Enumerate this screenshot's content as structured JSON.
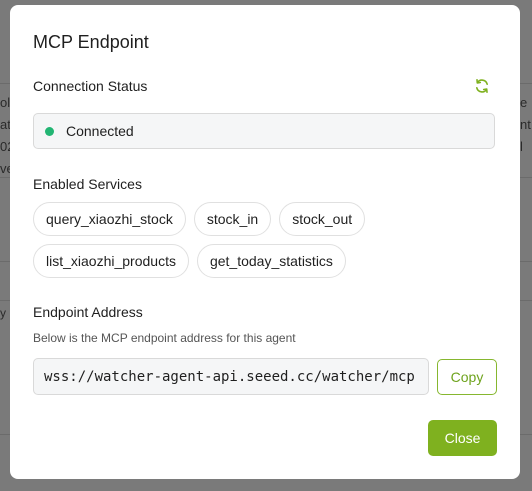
{
  "background": {
    "left_fragment": [
      "ol",
      "at",
      "02",
      "ve"
    ],
    "right_fragment": [
      "e",
      "nt,",
      "l",
      ""
    ],
    "small_left_fragment": "y"
  },
  "modal": {
    "title": "MCP Endpoint",
    "connection": {
      "label": "Connection Status",
      "status": "Connected",
      "status_color": "#22b573",
      "refresh_icon": "refresh-icon"
    },
    "services": {
      "label": "Enabled Services",
      "rows": [
        [
          "query_xiaozhi_stock",
          "stock_in",
          "stock_out"
        ],
        [
          "list_xiaozhi_products",
          "get_today_statistics"
        ]
      ]
    },
    "endpoint": {
      "label": "Endpoint Address",
      "hint": "Below is the MCP endpoint address for this agent",
      "value": "wss://watcher-agent-api.seeed.cc/watcher/mcp",
      "copy_label": "Copy"
    },
    "close_label": "Close",
    "accent_color": "#7fb11f"
  }
}
